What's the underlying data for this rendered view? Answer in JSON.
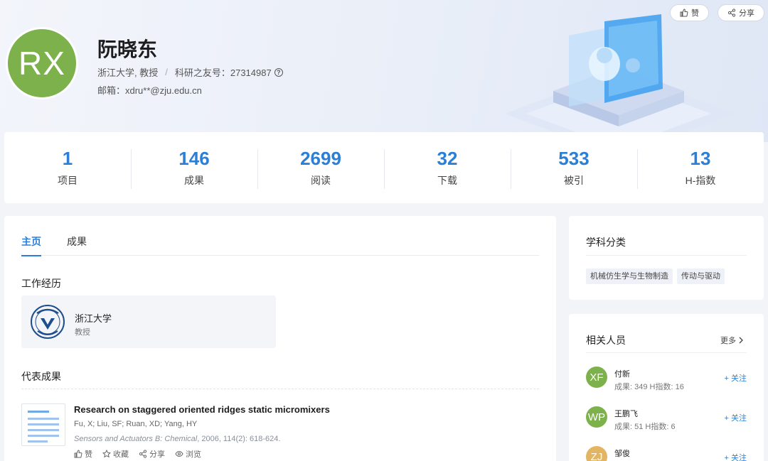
{
  "header": {
    "avatar_initials": "RX",
    "name": "阮晓东",
    "affiliation": "浙江大学, 教授",
    "separator": "/",
    "friend_id_label": "科研之友号：27314987",
    "email": "邮箱：xdru**@zju.edu.cn",
    "like_label": "赞",
    "share_label": "分享"
  },
  "stats": [
    {
      "value": "1",
      "label": "项目"
    },
    {
      "value": "146",
      "label": "成果"
    },
    {
      "value": "2699",
      "label": "阅读"
    },
    {
      "value": "32",
      "label": "下载"
    },
    {
      "value": "533",
      "label": "被引"
    },
    {
      "value": "13",
      "label": "H-指数"
    }
  ],
  "tabs": [
    {
      "label": "主页",
      "active": true
    },
    {
      "label": "成果",
      "active": false
    }
  ],
  "work": {
    "title": "工作经历",
    "org": "浙江大学",
    "position": "教授"
  },
  "publications": {
    "title": "代表成果",
    "items": [
      {
        "title": "Research on staggered oriented ridges static micromixers",
        "authors": "Fu, X; Liu, SF; Ruan, XD; Yang, HY",
        "journal": "Sensors and Actuators B: Chemical",
        "details": ", 2006, 114(2): 618-624.",
        "actions": {
          "like": "赞",
          "favorite": "收藏",
          "share": "分享",
          "view": "浏览"
        }
      }
    ]
  },
  "subjects": {
    "title": "学科分类",
    "tags": [
      "机械仿生学与生物制造",
      "传动与驱动"
    ]
  },
  "related": {
    "title": "相关人员",
    "more_label": "更多",
    "people": [
      {
        "initials": "XF",
        "name": "付新",
        "meta": "成果: 349   H指数: 16",
        "follow": "关注",
        "color": "#7cb14b"
      },
      {
        "initials": "WP",
        "name": "王鹏飞",
        "meta": "成果: 51   H指数: 6",
        "follow": "关注",
        "color": "#7cb14b"
      },
      {
        "initials": "ZJ",
        "name": "邹俊",
        "meta": "",
        "follow": "关注",
        "color": "#e3b562"
      }
    ]
  },
  "colors": {
    "accent": "#2b7fd6",
    "avatar_green": "#7cb14b"
  }
}
